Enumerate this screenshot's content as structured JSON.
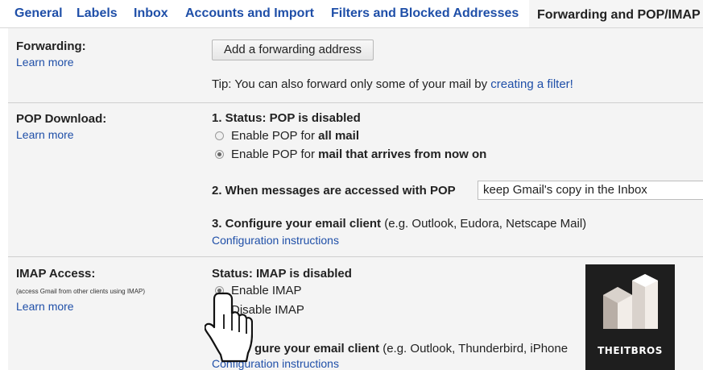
{
  "tabs": [
    {
      "label": "General"
    },
    {
      "label": "Labels"
    },
    {
      "label": "Inbox"
    },
    {
      "label": "Accounts and Import"
    },
    {
      "label": "Filters and Blocked Addresses"
    },
    {
      "label": "Forwarding and POP/IMAP",
      "active": true
    }
  ],
  "forwarding": {
    "title": "Forwarding:",
    "learn_more": "Learn more",
    "button": "Add a forwarding address",
    "tip_prefix": "Tip: You can also forward only some of your mail by ",
    "tip_link": "creating a filter!"
  },
  "pop": {
    "title": "POP Download:",
    "learn_more": "Learn more",
    "status": "1. Status: POP is disabled",
    "option1_prefix": "Enable POP for ",
    "option1_bold": "all mail",
    "option2_prefix": "Enable POP for ",
    "option2_bold": "mail that arrives from now on",
    "access_label": "2. When messages are accessed with POP",
    "access_select": "keep Gmail's copy in the Inbox",
    "configure_bold": "3. Configure your email client",
    "configure_rest": " (e.g. Outlook, Eudora, Netscape Mail)",
    "config_link": "Configuration instructions"
  },
  "imap": {
    "title": "IMAP Access:",
    "note": "(access Gmail from other clients using IMAP)",
    "learn_more": "Learn more",
    "status": "Status: IMAP is disabled",
    "enable": "Enable IMAP",
    "disable": "Disable IMAP",
    "configure_bold": "gure your email client",
    "configure_rest": " (e.g. Outlook, Thunderbird, iPhone",
    "config_link": "Configuration instructions"
  },
  "logo": {
    "text": "THEITBROS",
    "colors": {
      "background": "#1e1e1e",
      "light": "#f2ede8",
      "mid": "#b8aea6"
    }
  },
  "colors": {
    "link": "#1f4fa8",
    "section_bg": "#f4f4f4"
  }
}
